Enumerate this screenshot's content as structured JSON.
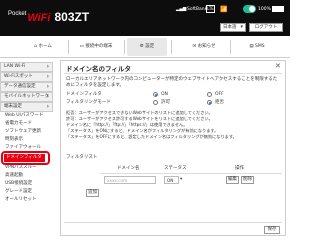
{
  "header": {
    "logo_small": "Pocket",
    "logo_brand": "WiFi",
    "model": "803ZT",
    "carrier": "SoftBank",
    "network": "4G",
    "lte_badge": "LTE",
    "battery_pct": "100%",
    "language": "日本語",
    "logout_label": "ログアウト"
  },
  "tabs": [
    {
      "label": "ホーム"
    },
    {
      "label": "接続中の端末"
    },
    {
      "label": "設定"
    },
    {
      "label": "お知らせ"
    },
    {
      "label": "SMS"
    }
  ],
  "sidebar": {
    "items": [
      "LAN Wi-Fi",
      "Wi-Fiスポット",
      "データ通信設定",
      "モバイルネットワーク",
      "端末設定"
    ],
    "subitems": [
      "Web UIパスワード",
      "省電力モード",
      "ソフトウェア更新",
      "時刻表示",
      "ファイアウォール"
    ],
    "highlighted": "ドメインフィルタ",
    "subitems2": [
      "VPNパススルー",
      "高速起動",
      "USB接続設定",
      "グレード設定",
      "オールリセット"
    ]
  },
  "panel": {
    "title": "ドメイン名のフィルタ",
    "close_symbol": "✕",
    "description": "ローカルエリアネットワーク内のコンピューターが特定のウェブサイトへアクセスすることを制限するためにフィルタを設定します。",
    "domain_filter_label": "ドメインフィルタ",
    "on_label": "ON",
    "off_label": "OFF",
    "mode_label": "フィルタリングモード",
    "allow_label": "許可",
    "deny_label": "拒否",
    "notes": [
      "拒否：ユーザーがアクセスできないWebサイトのリストに追加してください。",
      "許可：ユーザーがアクセス許可するWebサイトをリストに追加してください。",
      "ドメイン名に「http://」「ftp://」「https://」は使用できません。",
      "「ステータス」をONにすると、ドメイン名がフィルタリングが有効になります。",
      "「ステータス」をOFFにすると、設定したドメイン名はフィルタリングが無効になります。"
    ],
    "list_heading": "フィルタリスト",
    "col_domain": "ドメイン名",
    "col_status": "ステータス",
    "col_action": "操作",
    "domain_placeholder": "xxxx.com",
    "status_value": "ON",
    "edit_label": "編集",
    "delete_label": "削除",
    "add_label": "追加",
    "save_label": "保存"
  }
}
